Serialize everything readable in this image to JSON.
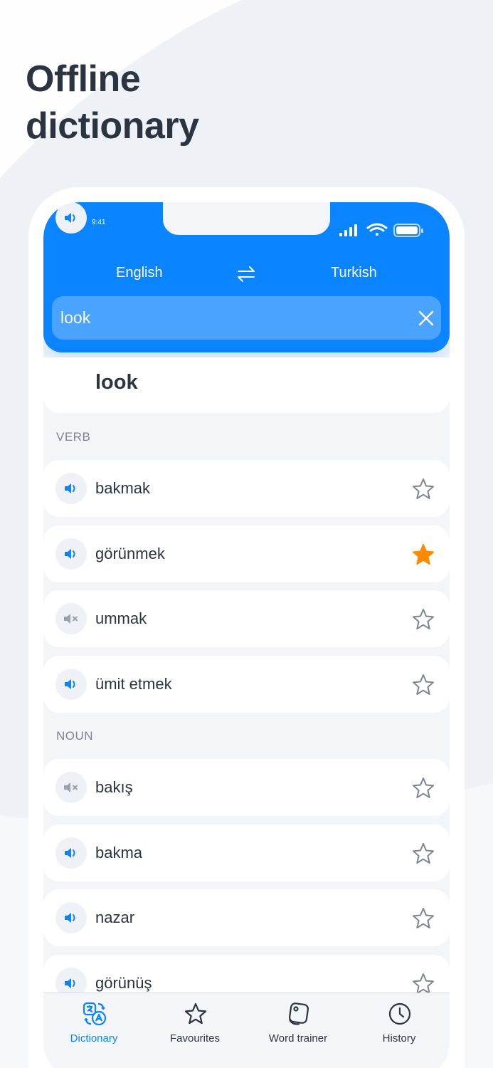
{
  "promo": {
    "headline_line1": "Offline",
    "headline_line2": "dictionary"
  },
  "status_bar": {
    "time": "9:41"
  },
  "languages": {
    "source": "English",
    "target": "Turkish"
  },
  "search": {
    "value": "look"
  },
  "entry": {
    "word": "look"
  },
  "sections": [
    {
      "label": "VERB",
      "items": [
        {
          "word": "bakmak",
          "audio": "speaker-icon",
          "favourite": false
        },
        {
          "word": "görünmek",
          "audio": "speaker-icon",
          "favourite": true
        },
        {
          "word": "ummak",
          "audio": "speaker-muted-icon",
          "favourite": false
        },
        {
          "word": "ümit etmek",
          "audio": "speaker-icon",
          "favourite": false
        }
      ]
    },
    {
      "label": "NOUN",
      "items": [
        {
          "word": "bakış",
          "audio": "speaker-muted-icon",
          "favourite": false
        },
        {
          "word": "bakma",
          "audio": "speaker-icon",
          "favourite": false
        },
        {
          "word": "nazar",
          "audio": "speaker-icon",
          "favourite": false
        },
        {
          "word": "görünüş",
          "audio": "speaker-icon",
          "favourite": false
        }
      ]
    }
  ],
  "tabbar": {
    "tabs": [
      {
        "label": "Dictionary",
        "icon": "dictionary-icon",
        "active": true
      },
      {
        "label": "Favourites",
        "icon": "star-icon",
        "active": false
      },
      {
        "label": "Word trainer",
        "icon": "cards-icon",
        "active": false
      },
      {
        "label": "History",
        "icon": "clock-icon",
        "active": false
      }
    ]
  },
  "colors": {
    "accent": "#0a84ff",
    "favourite": "#ff8a00",
    "text": "#2b3440",
    "muted": "#9aa2ad"
  }
}
